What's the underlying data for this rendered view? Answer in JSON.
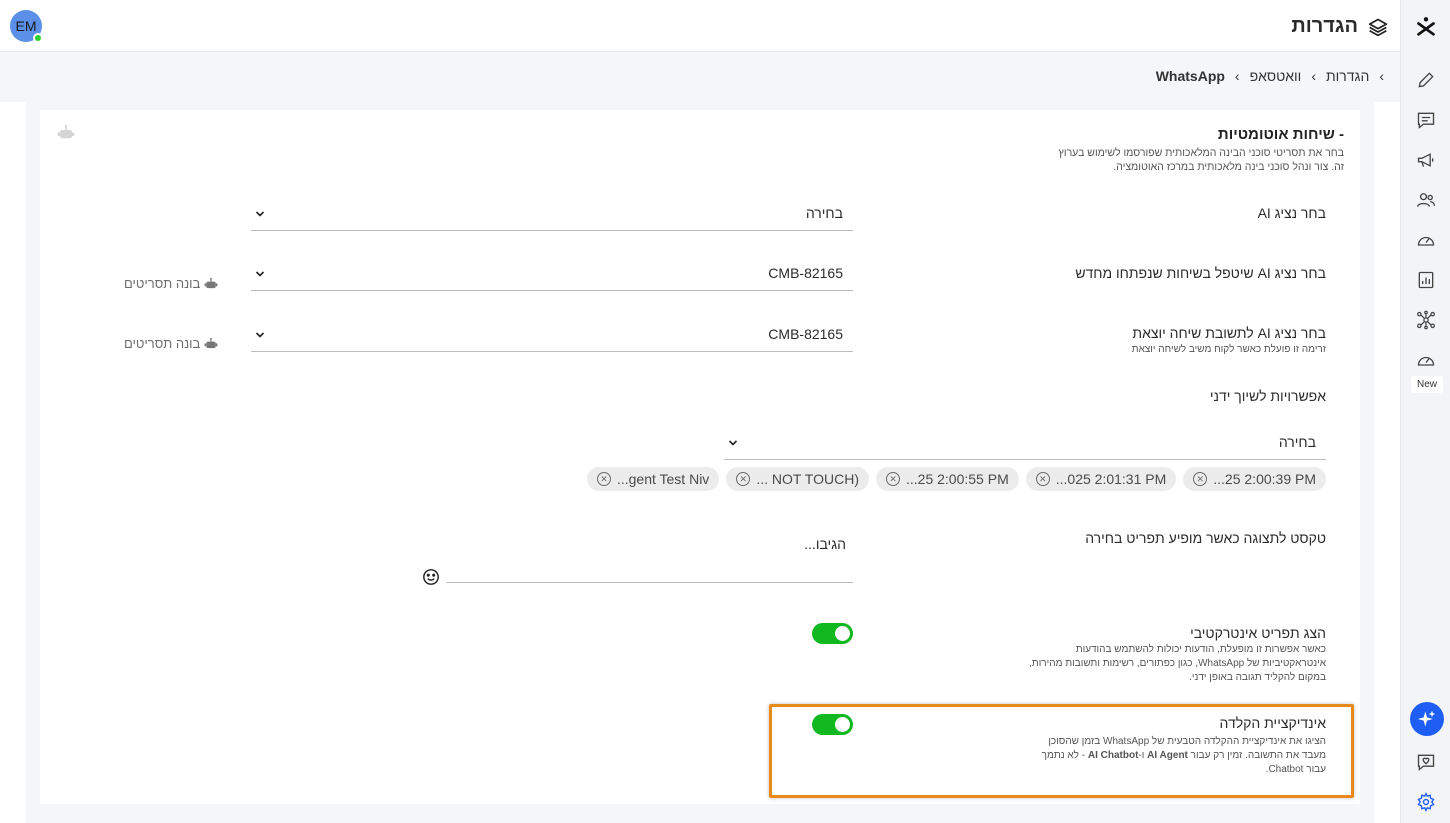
{
  "header": {
    "title": "הגדרות",
    "avatar_initials": "EM"
  },
  "breadcrumb": {
    "items": [
      "הגדרות",
      "וואטסאפ",
      "WhatsApp"
    ]
  },
  "rail": {
    "icons": [
      "logo-icon",
      "pencil-icon",
      "chat-icon",
      "megaphone-icon",
      "contacts-icon",
      "gauge-icon",
      "report-icon",
      "network-icon",
      "gauge-new-icon",
      "ai-sparkle-icon",
      "heart-chat-icon",
      "settings-icon"
    ],
    "new_badge": "New"
  },
  "section": {
    "title": "- שיחות אוטומטיות",
    "description": "בחר את תסריטי סוכני הבינה המלאכותית שפורסמו לשימוש בערוץ זה. צור ונהל סוכני בינה מלאכותית במרכז האוטומציה."
  },
  "fields": {
    "ai_agent": {
      "label": "בחר נציג AI",
      "value": "בחירה"
    },
    "new_chat_agent": {
      "label": "בחר נציג AI שיטפל בשיחות שנפתחו מחדש",
      "value": "CMB-82165",
      "builder": "בונה תסריטים"
    },
    "outgoing_agent": {
      "label": "בחר נציג AI לתשובת שיחה יוצאת",
      "sub": "זרימה זו פועלת כאשר לקוח משיב לשיחה יוצאת",
      "value": "CMB-82165",
      "builder": "בונה תסריטים"
    },
    "manual_assign": {
      "label": "אפשרויות לשיוך ידני",
      "value": "בחירה",
      "chips": [
        "...25 2:00:39 PM",
        "...025 2:01:31 PM",
        "...25 2:00:55 PM",
        "... NOT TOUCH)",
        "...gent Test Niv"
      ]
    },
    "menu_text": {
      "label": "טקסט לתצוגה כאשר מופיע תפריט בחירה",
      "value": "הגיבו..."
    },
    "interactive_menu": {
      "label": "הצג תפריט אינטרקטיבי",
      "sub_lines": [
        "כאשר אפשרות זו מופעלת, הודעות יכולות להשתמש בהודעות",
        "אינטראקטיביות של WhatsApp, כגון כפתורים, רשימות ותשובות מהירות,",
        "במקום להקליד תגובה באופן ידני."
      ],
      "enabled": true
    },
    "typing_indicator": {
      "label": "אינדיקציית הקלדה",
      "sub_line1": "הציגו את אינדיקציית ההקלדה הטבעית של WhatsApp בזמן שהסוכן",
      "sub_line2_a": "מעבד את התשובה. זמין רק עבור ",
      "sub_line2_b": "AI Agent",
      "sub_line2_c": " ו-",
      "sub_line2_d": "AI Chatbot",
      "sub_line2_e": " - לא נתמך",
      "sub_line3": "עבור Chatbot.",
      "enabled": true
    }
  },
  "colors": {
    "toggle_on": "#12b81f",
    "highlight": "#e88a1a",
    "ai_fab": "#1f5ef5"
  }
}
